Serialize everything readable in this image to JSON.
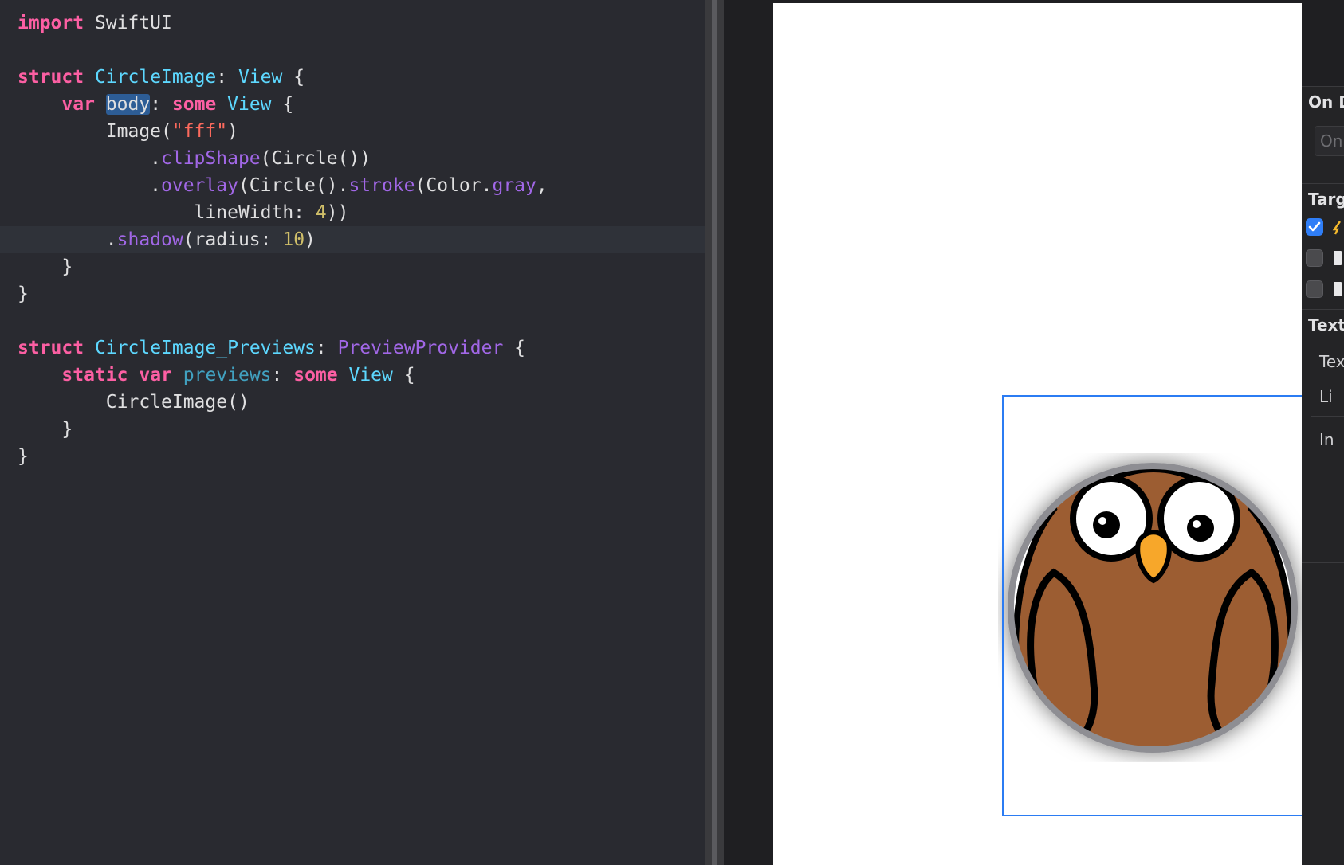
{
  "editor": {
    "lines": [
      {
        "tokens": [
          {
            "t": "import",
            "c": "kw"
          },
          {
            "t": " SwiftUI",
            "c": "ph"
          }
        ]
      },
      {
        "tokens": []
      },
      {
        "tokens": [
          {
            "t": "struct",
            "c": "kw"
          },
          {
            "t": " ",
            "c": "ph"
          },
          {
            "t": "CircleImage",
            "c": "ty"
          },
          {
            "t": ": ",
            "c": "ph"
          },
          {
            "t": "View",
            "c": "ty"
          },
          {
            "t": " {",
            "c": "ph"
          }
        ]
      },
      {
        "tokens": [
          {
            "t": "    ",
            "c": "ph"
          },
          {
            "t": "var",
            "c": "kw"
          },
          {
            "t": " ",
            "c": "ph"
          },
          {
            "t": "body",
            "c": "sel"
          },
          {
            "t": ": ",
            "c": "ph"
          },
          {
            "t": "some",
            "c": "kw"
          },
          {
            "t": " ",
            "c": "ph"
          },
          {
            "t": "View",
            "c": "ty"
          },
          {
            "t": " {",
            "c": "ph"
          }
        ]
      },
      {
        "tokens": [
          {
            "t": "        Image(",
            "c": "ph"
          },
          {
            "t": "\"fff\"",
            "c": "st"
          },
          {
            "t": ")",
            "c": "ph"
          }
        ]
      },
      {
        "tokens": [
          {
            "t": "            .",
            "c": "ph"
          },
          {
            "t": "clipShape",
            "c": "me"
          },
          {
            "t": "(Circle())",
            "c": "ph"
          }
        ]
      },
      {
        "tokens": [
          {
            "t": "            .",
            "c": "ph"
          },
          {
            "t": "overlay",
            "c": "me"
          },
          {
            "t": "(Circle().",
            "c": "ph"
          },
          {
            "t": "stroke",
            "c": "me"
          },
          {
            "t": "(Color.",
            "c": "ph"
          },
          {
            "t": "gray",
            "c": "me"
          },
          {
            "t": ",",
            "c": "ph"
          }
        ]
      },
      {
        "tokens": [
          {
            "t": "                lineWidth: ",
            "c": "ph"
          },
          {
            "t": "4",
            "c": "nu"
          },
          {
            "t": "))",
            "c": "ph"
          }
        ]
      },
      {
        "tokens": [
          {
            "t": "        .",
            "c": "ph"
          },
          {
            "t": "shadow",
            "c": "me"
          },
          {
            "t": "(radius: ",
            "c": "ph"
          },
          {
            "t": "10",
            "c": "nu"
          },
          {
            "t": ")",
            "c": "ph"
          }
        ],
        "current": true
      },
      {
        "tokens": [
          {
            "t": "    }",
            "c": "ph"
          }
        ]
      },
      {
        "tokens": [
          {
            "t": "}",
            "c": "ph"
          }
        ]
      },
      {
        "tokens": []
      },
      {
        "tokens": [
          {
            "t": "struct",
            "c": "kw"
          },
          {
            "t": " ",
            "c": "ph"
          },
          {
            "t": "CircleImage_Previews",
            "c": "ty"
          },
          {
            "t": ": ",
            "c": "ph"
          },
          {
            "t": "PreviewProvider",
            "c": "me"
          },
          {
            "t": " {",
            "c": "ph"
          }
        ]
      },
      {
        "tokens": [
          {
            "t": "    ",
            "c": "ph"
          },
          {
            "t": "static",
            "c": "kw"
          },
          {
            "t": " ",
            "c": "ph"
          },
          {
            "t": "var",
            "c": "kw"
          },
          {
            "t": " ",
            "c": "ph"
          },
          {
            "t": "previews",
            "c": "fn"
          },
          {
            "t": ": ",
            "c": "ph"
          },
          {
            "t": "some",
            "c": "kw"
          },
          {
            "t": " ",
            "c": "ph"
          },
          {
            "t": "View",
            "c": "ty"
          },
          {
            "t": " {",
            "c": "ph"
          }
        ]
      },
      {
        "tokens": [
          {
            "t": "        CircleImage()",
            "c": "ph"
          }
        ]
      },
      {
        "tokens": [
          {
            "t": "    }",
            "c": "ph"
          }
        ]
      },
      {
        "tokens": [
          {
            "t": "}",
            "c": "ph"
          }
        ]
      }
    ]
  },
  "inspector": {
    "on_demand_header": "On D",
    "on_demand_placeholder": "On",
    "target_header": "Targ",
    "targets": [
      {
        "checked": true
      },
      {
        "checked": false
      },
      {
        "checked": false
      }
    ],
    "text_header": "Text",
    "text_label": "Tex",
    "line_label": "Li",
    "indent_label": "In"
  },
  "preview": {
    "stroke_color": "#8e8e93",
    "selection_color": "#2b7cf3"
  }
}
